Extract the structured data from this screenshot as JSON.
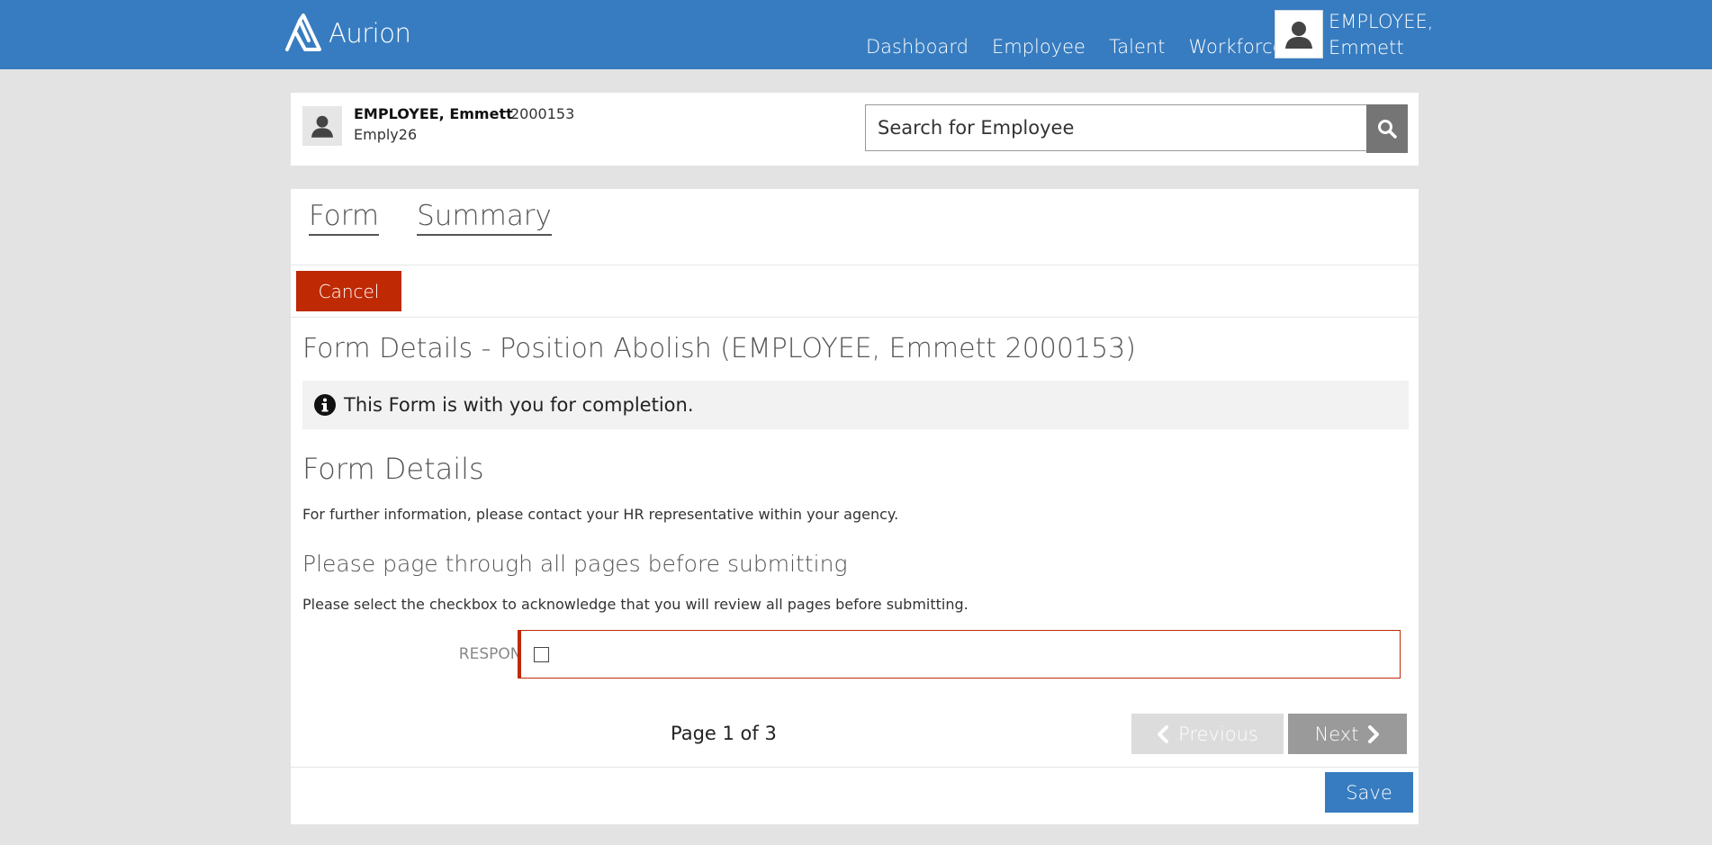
{
  "app": {
    "name": "Aurion"
  },
  "nav": {
    "items": [
      "Dashboard",
      "Employee",
      "Talent",
      "Workforce"
    ]
  },
  "user": {
    "line1": "EMPLOYEE,",
    "line2": "Emmett"
  },
  "employee": {
    "name": "EMPLOYEE, Emmett",
    "id": "2000153",
    "username": "Emply26"
  },
  "search": {
    "placeholder": "Search for Employee"
  },
  "tabs": [
    "Form",
    "Summary"
  ],
  "buttons": {
    "cancel": "Cancel",
    "previous": "Previous",
    "next": "Next",
    "save": "Save"
  },
  "form": {
    "title": "Form Details - Position Abolish (EMPLOYEE, Emmett 2000153)",
    "info": "This Form is with you for completion.",
    "section_title": "Form Details",
    "section_text": "For further information, please contact your HR representative within your agency.",
    "subsection_title": "Please page through all pages before submitting",
    "subsection_text": "Please select the checkbox to acknowledge that you will review all pages before submitting.",
    "response_label": "RESPONSE",
    "response_checked": false,
    "page_info": "Page 1 of 3"
  },
  "colors": {
    "header": "#377cc0",
    "cancel": "#bf2a05",
    "save": "#377cc0"
  }
}
